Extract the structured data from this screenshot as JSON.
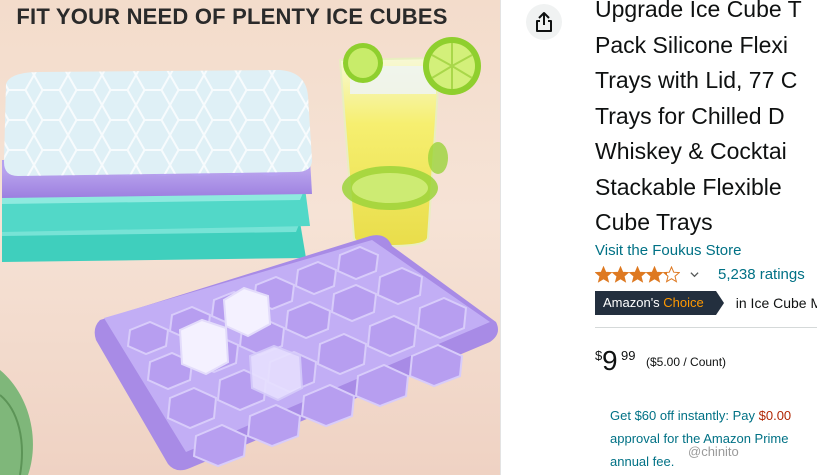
{
  "image": {
    "banner_text": "FIT YOUR NEED OF PLENTY ICE CUBES",
    "colors": {
      "background": "#f3dccb",
      "purple": "#a88be6",
      "teal": "#3ccfc0",
      "lid": "#dff0f6",
      "lemon": "#f3ec62",
      "lime": "#8fcf2e"
    }
  },
  "share": {
    "icon": "share-icon"
  },
  "title_lines": [
    "Upgrade Ice Cube T",
    "Pack Silicone Flexi",
    "Trays with Lid, 77 C",
    "Trays for Chilled D",
    "Whiskey & Cocktai",
    "Stackable Flexible",
    "Cube Trays"
  ],
  "store_link": "Visit the Foukus Store",
  "rating": {
    "stars": 4.2,
    "count_text": "5,238 ratings",
    "star_color": "#de7921"
  },
  "badge": {
    "prefix": "Amazon's",
    "accent": "Choice",
    "category_text": "in Ice Cube M"
  },
  "price": {
    "symbol": "$",
    "whole": "9",
    "fraction": "99",
    "unit_price": "($5.00 / Count)"
  },
  "promo": {
    "line1_start": "Get $60 off instantly: Pay ",
    "line1_amount": "$0.00",
    "line2": "approval for the Amazon Prime",
    "line3": "annual fee."
  },
  "watermark": "@chinito"
}
